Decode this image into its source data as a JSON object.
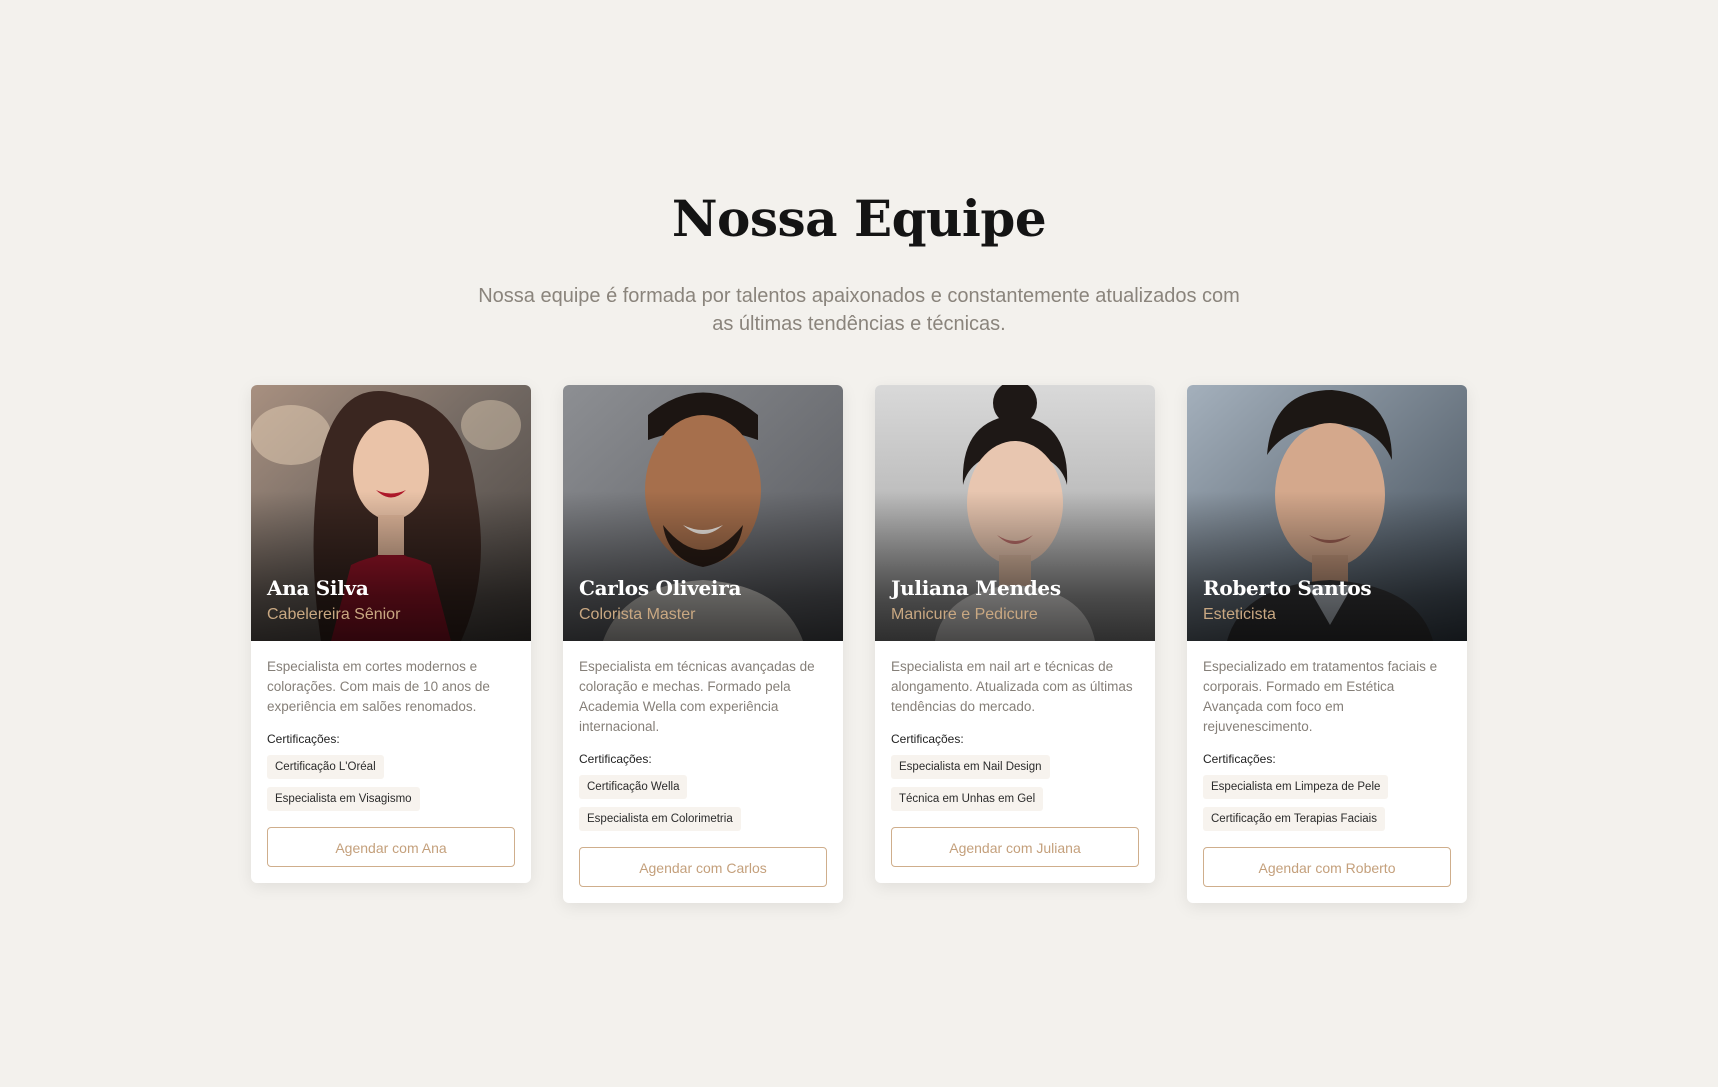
{
  "section": {
    "title": "Nossa Equipe",
    "subtitle": "Nossa equipe é formada por talentos apaixonados e constantemente atualizados com as últimas tendências e técnicas."
  },
  "colors": {
    "background": "#f3f1ed",
    "accent": "#c9a882",
    "title": "#141414",
    "muted_text": "#857f78"
  },
  "team": [
    {
      "name": "Ana Silva",
      "role": "Cabelereira Sênior",
      "bio": "Especialista em cortes modernos e colorações. Com mais de 10 anos de experiência em salões renomados.",
      "cert_label": "Certificações:",
      "certifications": [
        "Certificação L'Oréal",
        "Especialista em Visagismo"
      ],
      "button": "Agendar com Ana"
    },
    {
      "name": "Carlos Oliveira",
      "role": "Colorista Master",
      "bio": "Especialista em técnicas avançadas de coloração e mechas. Formado pela Academia Wella com experiência internacional.",
      "cert_label": "Certificações:",
      "certifications": [
        "Certificação Wella",
        "Especialista em Colorimetria"
      ],
      "button": "Agendar com Carlos"
    },
    {
      "name": "Juliana Mendes",
      "role": "Manicure e Pedicure",
      "bio": "Especialista em nail art e técnicas de alongamento. Atualizada com as últimas tendências do mercado.",
      "cert_label": "Certificações:",
      "certifications": [
        "Especialista em Nail Design",
        "Técnica em Unhas em Gel"
      ],
      "button": "Agendar com Juliana"
    },
    {
      "name": "Roberto Santos",
      "role": "Esteticista",
      "bio": "Especializado em tratamentos faciais e corporais. Formado em Estética Avançada com foco em rejuvenescimento.",
      "cert_label": "Certificações:",
      "certifications": [
        "Especialista em Limpeza de Pele",
        "Certificação em Terapias Faciais"
      ],
      "button": "Agendar com Roberto"
    }
  ]
}
